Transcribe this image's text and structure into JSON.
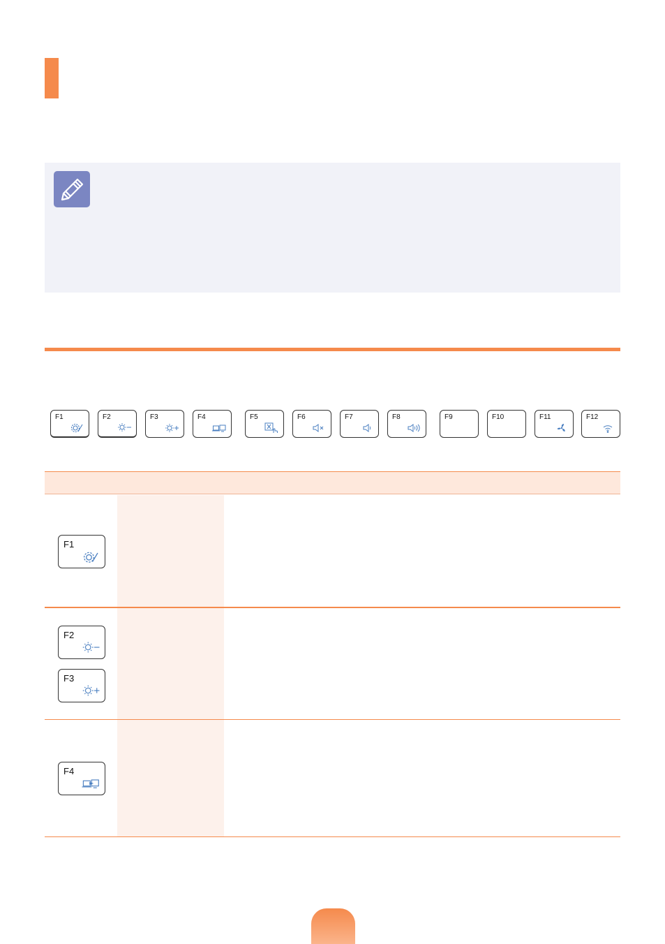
{
  "colors": {
    "accent": "#f58a4c",
    "note_bg": "#f1f2f8",
    "note_icon": "#7b86c2",
    "icon_blue": "#4a7fc0",
    "table_header_bg": "#fee8dc",
    "column_bg": "#fdf1eb"
  },
  "keyboard_strip": {
    "keys": [
      {
        "label": "F1",
        "icon": "settings-icon"
      },
      {
        "label": "F2",
        "icon": "brightness-down-icon"
      },
      {
        "label": "F3",
        "icon": "brightness-up-icon"
      },
      {
        "label": "F4",
        "icon": "display-switch-icon"
      },
      {
        "label": "F5",
        "icon": "touchpad-toggle-icon"
      },
      {
        "label": "F6",
        "icon": "mute-icon"
      },
      {
        "label": "F7",
        "icon": "volume-down-icon"
      },
      {
        "label": "F8",
        "icon": "volume-up-icon"
      },
      {
        "label": "F9",
        "icon": ""
      },
      {
        "label": "F10",
        "icon": ""
      },
      {
        "label": "F11",
        "icon": "fan-icon"
      },
      {
        "label": "F12",
        "icon": "wireless-icon"
      }
    ]
  },
  "table": {
    "rows": [
      {
        "keys": [
          {
            "label": "F1",
            "icon": "settings-icon"
          }
        ]
      },
      {
        "keys": [
          {
            "label": "F2",
            "icon": "brightness-down-icon"
          },
          {
            "label": "F3",
            "icon": "brightness-up-icon"
          }
        ]
      },
      {
        "keys": [
          {
            "label": "F4",
            "icon": "display-switch-icon"
          }
        ]
      }
    ]
  }
}
